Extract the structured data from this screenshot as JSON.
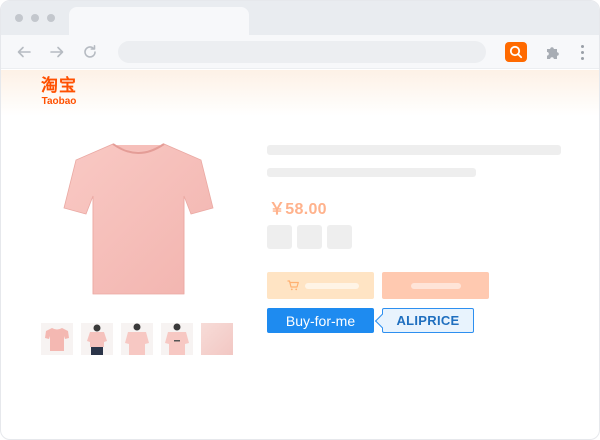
{
  "site": {
    "logo_cn": "淘宝",
    "logo_en": "Taobao",
    "brand_color": "#ff5000"
  },
  "browser": {
    "icons": [
      "back-arrow-icon",
      "forward-arrow-icon",
      "reload-icon",
      "search-extension-icon",
      "puzzle-extension-icon",
      "menu-dots-icon"
    ],
    "extension_color": "#ff6a00"
  },
  "product": {
    "price": "￥58.00",
    "color": "pink",
    "thumbnail_count": 5
  },
  "actions": {
    "buy_for_me_label": "Buy-for-me",
    "aliprice_label": "ALIPRICE",
    "buy_for_me_color": "#1e8bf0",
    "cart_icon": "cart-icon"
  }
}
